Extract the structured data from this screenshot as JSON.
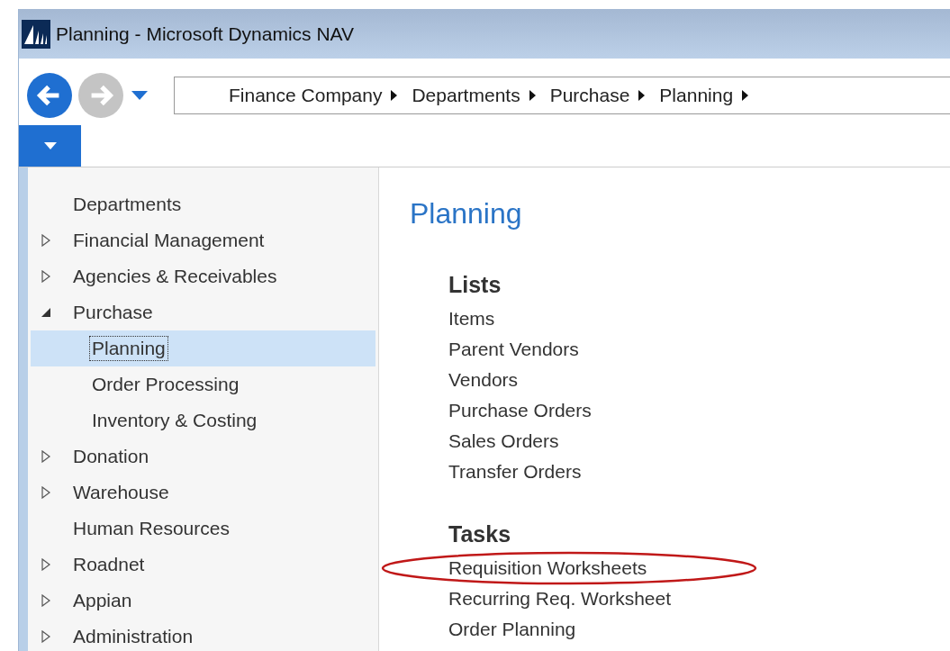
{
  "window": {
    "title": "Planning - Microsoft Dynamics NAV"
  },
  "navigation": {
    "back_enabled": true,
    "forward_enabled": false
  },
  "breadcrumb": [
    "Finance Company",
    "Departments",
    "Purchase",
    "Planning"
  ],
  "sidebar": {
    "items": [
      {
        "label": "Departments",
        "selected": false
      },
      {
        "label": "Financial Management",
        "expanded": false,
        "selected": false
      },
      {
        "label": "Agencies & Receivables",
        "expanded": false,
        "selected": false
      },
      {
        "label": "Purchase",
        "expanded": true,
        "selected": false,
        "children": [
          {
            "label": "Planning",
            "selected": true
          },
          {
            "label": "Order Processing",
            "selected": false
          },
          {
            "label": "Inventory & Costing",
            "selected": false
          }
        ]
      },
      {
        "label": "Donation",
        "expanded": false,
        "selected": false
      },
      {
        "label": "Warehouse",
        "expanded": false,
        "selected": false
      },
      {
        "label": "Human Resources",
        "selected": false
      },
      {
        "label": "Roadnet",
        "expanded": false,
        "selected": false
      },
      {
        "label": "Appian",
        "expanded": false,
        "selected": false
      },
      {
        "label": "Administration",
        "expanded": false,
        "selected": false
      }
    ]
  },
  "page": {
    "title": "Planning",
    "groups": [
      {
        "heading": "Lists",
        "items": [
          {
            "label": "Items",
            "circled": false
          },
          {
            "label": "Parent Vendors",
            "circled": false
          },
          {
            "label": "Vendors",
            "circled": false
          },
          {
            "label": "Purchase Orders",
            "circled": false
          },
          {
            "label": "Sales Orders",
            "circled": false
          },
          {
            "label": "Transfer Orders",
            "circled": false
          }
        ]
      },
      {
        "heading": "Tasks",
        "items": [
          {
            "label": "Requisition Worksheets",
            "circled": true
          },
          {
            "label": "Recurring Req. Worksheet",
            "circled": false
          },
          {
            "label": "Order Planning",
            "circled": false
          }
        ]
      }
    ]
  }
}
